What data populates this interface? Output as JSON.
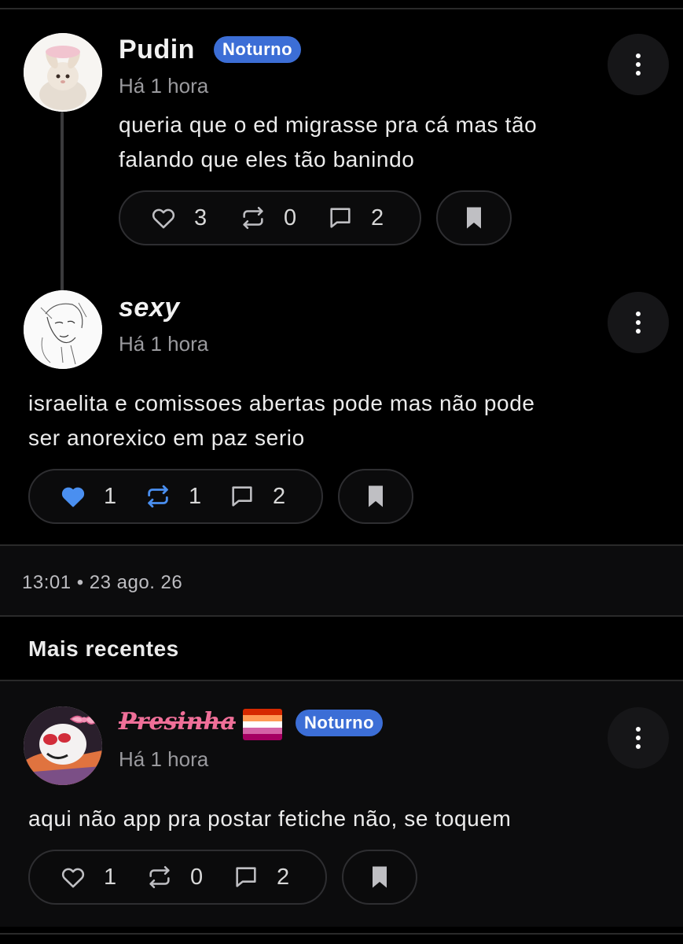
{
  "posts": [
    {
      "author": "Pudin",
      "badge": "Noturno",
      "time": "Há 1 hora",
      "text_line1": "queria que o ed migrasse pra cá mas tão",
      "text_line2": "falando que eles tão banindo",
      "likes": "3",
      "reposts": "0",
      "comments": "2",
      "liked": false,
      "reposted": false
    },
    {
      "author": "sexy",
      "time": "Há 1 hora",
      "text_line1": "israelita e comissoes abertas pode mas não pode",
      "text_line2": "ser anorexico em paz serio",
      "likes": "1",
      "reposts": "1",
      "comments": "2",
      "liked": true,
      "reposted": true
    }
  ],
  "post_datetime": "13:01 • 23 ago. 26",
  "section": {
    "title": "Mais recentes"
  },
  "recent": [
    {
      "author": "Presinha",
      "badge": "Noturno",
      "time": "Há 1 hora",
      "text": "aqui não app pra postar fetiche não, se toquem",
      "likes": "1",
      "reposts": "0",
      "comments": "2",
      "liked": false,
      "reposted": false
    }
  ],
  "colors": {
    "background": "#000000",
    "panel": "#0c0c0d",
    "badge": "#3c6ed6",
    "active_blue": "#4a8ff0",
    "muted_text": "#9a9a9e",
    "icon": "#bfbfc3",
    "name_pink": "#ef6f98"
  },
  "icons": [
    "heart-icon",
    "repost-icon",
    "comment-icon",
    "bookmark-icon",
    "more-vertical-icon"
  ]
}
